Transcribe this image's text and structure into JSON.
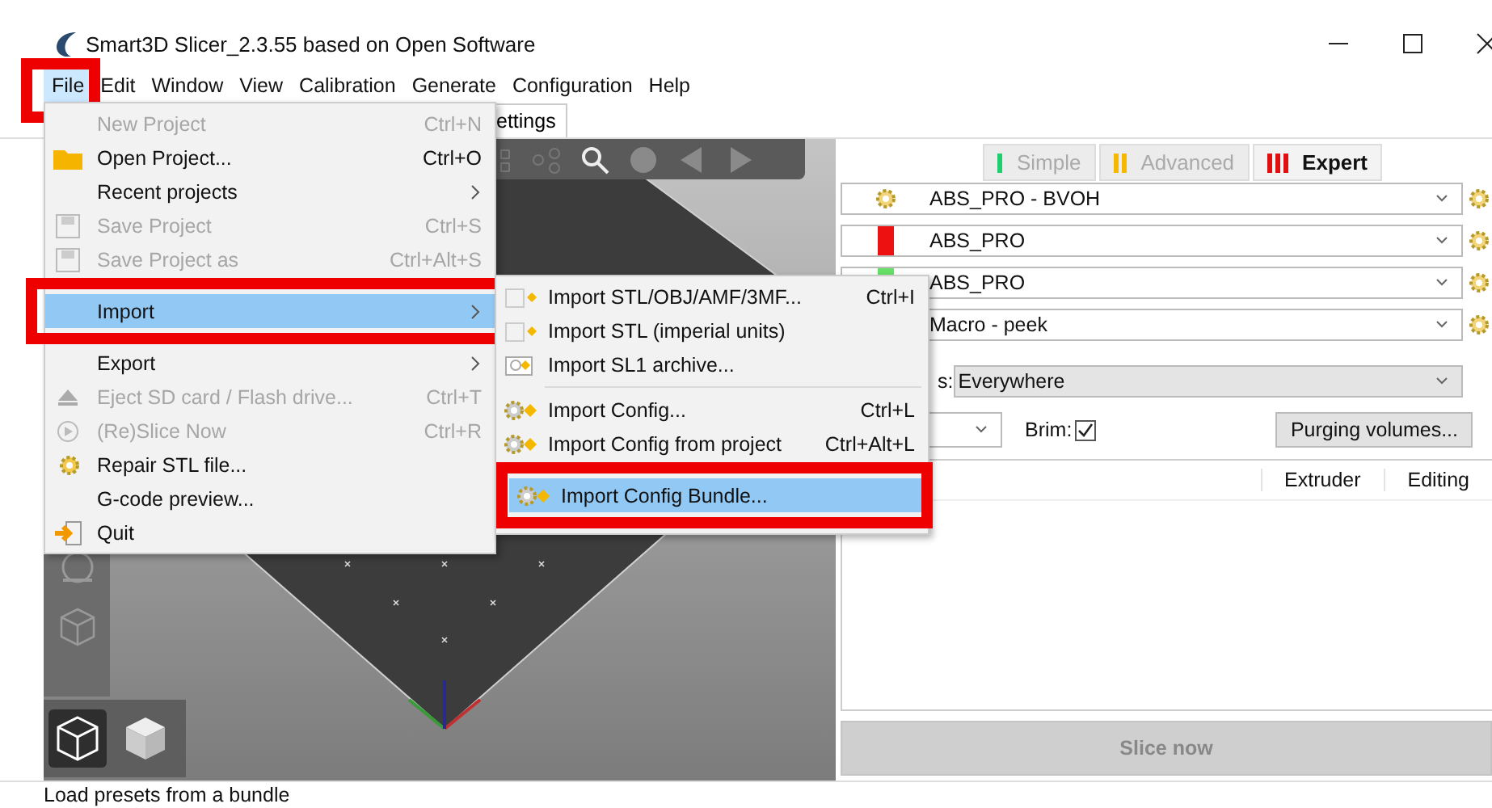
{
  "window": {
    "title": "Smart3D Slicer_2.3.55 based on Open Software"
  },
  "menu_bar": [
    {
      "label": "File",
      "selected": true
    },
    {
      "label": "Edit",
      "selected": false
    },
    {
      "label": "Window",
      "selected": false
    },
    {
      "label": "View",
      "selected": false
    },
    {
      "label": "Calibration",
      "selected": false
    },
    {
      "label": "Generate",
      "selected": false
    },
    {
      "label": "Configuration",
      "selected": false
    },
    {
      "label": "Help",
      "selected": false
    }
  ],
  "tab": {
    "label": "ettings"
  },
  "mode_buttons": [
    {
      "label": "Simple",
      "selected": false,
      "color": "#1fcf6f"
    },
    {
      "label": "Advanced",
      "selected": false,
      "color": "#f5b800"
    },
    {
      "label": "Expert",
      "selected": true,
      "color": "#e01010"
    }
  ],
  "presets": [
    {
      "kind": "gear",
      "value": "ABS_PRO - BVOH"
    },
    {
      "kind": "swatch",
      "color": "#ee1111",
      "value": "ABS_PRO"
    },
    {
      "kind": "swatch",
      "color": "#66e066",
      "value": "ABS_PRO"
    },
    {
      "kind": "plain",
      "value": "Macro - peek"
    }
  ],
  "supports": {
    "label": "s:",
    "value": "Everywhere"
  },
  "brim": {
    "label": "Brim:",
    "checked": true
  },
  "purging_button": "Purging volumes...",
  "table": {
    "columns": [
      "Extruder",
      "Editing"
    ]
  },
  "slice_button": {
    "label": "Slice now",
    "disabled": true
  },
  "status_bar": {
    "text": "Load presets from a bundle"
  },
  "file_menu": [
    {
      "kind": "plain",
      "label": "New Project",
      "shortcut": "Ctrl+N",
      "disabled": true,
      "submenu": false,
      "selected": false
    },
    {
      "kind": "folder",
      "label": "Open Project...",
      "shortcut": "Ctrl+O",
      "disabled": false,
      "submenu": false,
      "selected": false
    },
    {
      "kind": "plain",
      "label": "Recent projects",
      "disabled": false,
      "submenu": true,
      "selected": false
    },
    {
      "kind": "floppy",
      "label": "Save Project",
      "shortcut": "Ctrl+S",
      "disabled": true,
      "submenu": false,
      "selected": false
    },
    {
      "kind": "floppy",
      "label": "Save Project as",
      "shortcut": "Ctrl+Alt+S",
      "disabled": true,
      "submenu": false,
      "selected": false
    },
    {
      "kind": "plain",
      "label": "Import",
      "disabled": false,
      "submenu": true,
      "selected": true
    },
    {
      "kind": "plain",
      "label": "Export",
      "disabled": false,
      "submenu": true,
      "selected": false
    },
    {
      "kind": "eject",
      "label": "Eject SD card / Flash drive...",
      "shortcut": "Ctrl+T",
      "disabled": true,
      "submenu": false,
      "selected": false
    },
    {
      "kind": "slice",
      "label": "(Re)Slice Now",
      "shortcut": "Ctrl+R",
      "disabled": true,
      "submenu": false,
      "selected": false
    },
    {
      "kind": "repair",
      "label": "Repair STL file...",
      "disabled": false,
      "submenu": false,
      "selected": false
    },
    {
      "kind": "plain",
      "label": "G-code preview...",
      "disabled": false,
      "submenu": false,
      "selected": false
    },
    {
      "kind": "quit",
      "label": "Quit",
      "disabled": false,
      "submenu": false,
      "selected": false
    }
  ],
  "import_menu": [
    {
      "kind": "model",
      "label": "Import STL/OBJ/AMF/3MF...",
      "shortcut": "Ctrl+I",
      "selected": false
    },
    {
      "kind": "model",
      "label": "Import STL (imperial units)",
      "selected": false
    },
    {
      "kind": "archive",
      "label": "Import SL1 archive...",
      "selected": false
    },
    {
      "kind": "separator"
    },
    {
      "kind": "config",
      "label": "Import Config...",
      "shortcut": "Ctrl+L",
      "selected": false
    },
    {
      "kind": "config",
      "label": "Import Config from project",
      "shortcut": "Ctrl+Alt+L",
      "selected": false
    },
    {
      "kind": "config",
      "label": "Import Config Bundle...",
      "selected": true
    }
  ]
}
